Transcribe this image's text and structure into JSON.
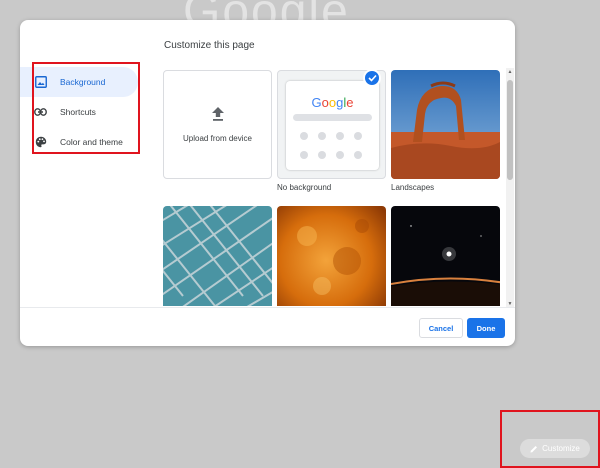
{
  "background_logo": "Google",
  "dialog": {
    "title": "Customize this page",
    "nav": [
      {
        "label": "Background",
        "icon": "image-icon",
        "active": true
      },
      {
        "label": "Shortcuts",
        "icon": "link-icon",
        "active": false
      },
      {
        "label": "Color and theme",
        "icon": "palette-icon",
        "active": false
      }
    ],
    "tiles": {
      "upload": {
        "label": "Upload from device",
        "icon": "upload-icon"
      },
      "no_background": {
        "label": "No background",
        "selected": true,
        "mini_logo": "Google"
      },
      "landscapes": {
        "label": "Landscapes"
      }
    },
    "buttons": {
      "cancel": "Cancel",
      "done": "Done"
    }
  },
  "customize_button": {
    "label": "Customize",
    "icon": "pencil-icon"
  },
  "colors": {
    "accent": "#1a73e8",
    "nav_active_bg": "#e8f0fe",
    "highlight": "#e0141e",
    "page_bg": "#c9c9c9"
  }
}
